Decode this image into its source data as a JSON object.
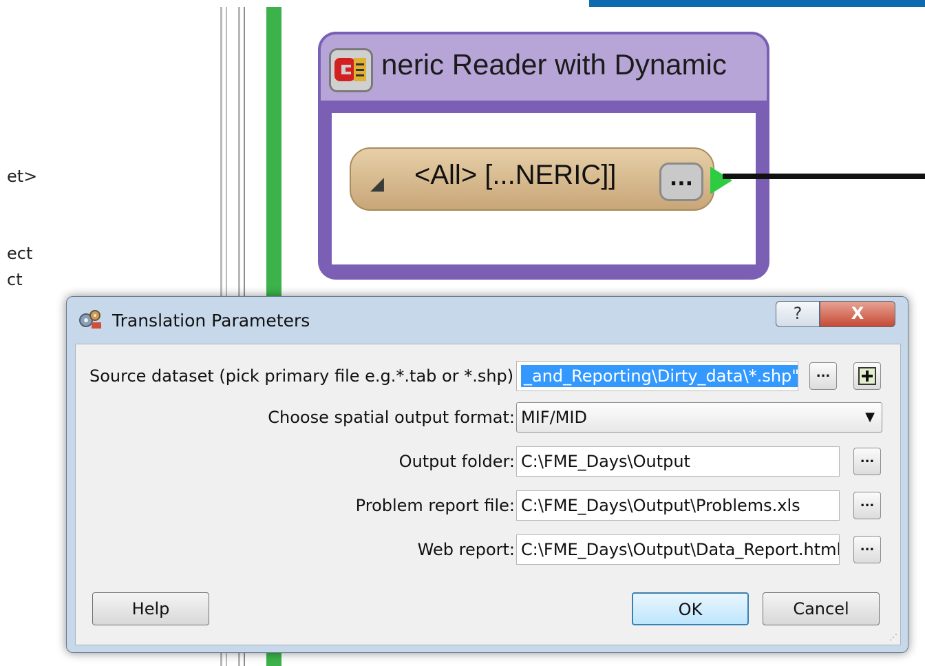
{
  "background": {
    "left_panel_fragments": [
      "et>",
      "ect",
      "ct"
    ],
    "reader": {
      "icon_name": "generic-reader-icon",
      "title": "neric Reader with Dynamic",
      "feature_type_label": "<All> [...NERIC]]",
      "feature_type_menu": "...",
      "collapse_glyph": "◢"
    },
    "colors": {
      "reader_border": "#7a5fb5",
      "reader_header": "#b8a5d8",
      "feature_type": "#d9bc90",
      "port": "#2ecc40",
      "green_bar": "#3cb34a",
      "blue_strip": "#0e6bb0"
    }
  },
  "dialog": {
    "title": "Translation Parameters",
    "icon_name": "translation-parameters-icon",
    "help_glyph": "?",
    "close_glyph": "X",
    "rows": [
      {
        "label": "Source dataset (pick primary file e.g.*.tab or *.shp) :",
        "value": "_and_Reporting\\Dirty_data\\*.shp\"",
        "browse_label": "...",
        "add_label": "+"
      },
      {
        "label": "Choose spatial output format:",
        "value": "MIF/MID",
        "arrow": "▼"
      },
      {
        "label": "Output folder:",
        "value": "C:\\FME_Days\\Output",
        "browse_label": "..."
      },
      {
        "label": "Problem report file:",
        "value": "C:\\FME_Days\\Output\\Problems.xls",
        "browse_label": "..."
      },
      {
        "label": "Web report:",
        "value": "C:\\FME_Days\\Output\\Data_Report.html",
        "browse_label": "..."
      }
    ],
    "buttons": {
      "help": "Help",
      "ok": "OK",
      "cancel": "Cancel"
    },
    "grip": "⋰"
  }
}
